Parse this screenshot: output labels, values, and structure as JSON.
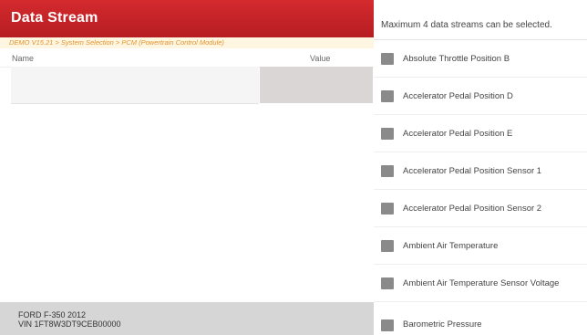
{
  "header": {
    "title": "Data Stream"
  },
  "breadcrumb": "DEMO V15.21 > System Selection > PCM (Powertrain Control Module)",
  "table": {
    "columns": {
      "name": "Name",
      "value": "Value"
    },
    "rows": [
      {
        "name": "",
        "value": ""
      }
    ]
  },
  "footer": {
    "vehicle": "FORD F-350 2012",
    "vin": "VIN 1FT8W3DT9CEB00000"
  },
  "selection": {
    "notice": "Maximum 4 data streams can be selected.",
    "options": [
      {
        "label": "Absolute Throttle Position B",
        "checked": false
      },
      {
        "label": "Accelerator Pedal Position D",
        "checked": false
      },
      {
        "label": "Accelerator Pedal Position E",
        "checked": false
      },
      {
        "label": "Accelerator Pedal Position Sensor 1",
        "checked": false
      },
      {
        "label": "Accelerator Pedal Position Sensor 2",
        "checked": false
      },
      {
        "label": "Ambient Air Temperature",
        "checked": false
      },
      {
        "label": "Ambient Air Temperature Sensor Voltage",
        "checked": false
      },
      {
        "label": "Barometric Pressure",
        "checked": false
      }
    ]
  }
}
